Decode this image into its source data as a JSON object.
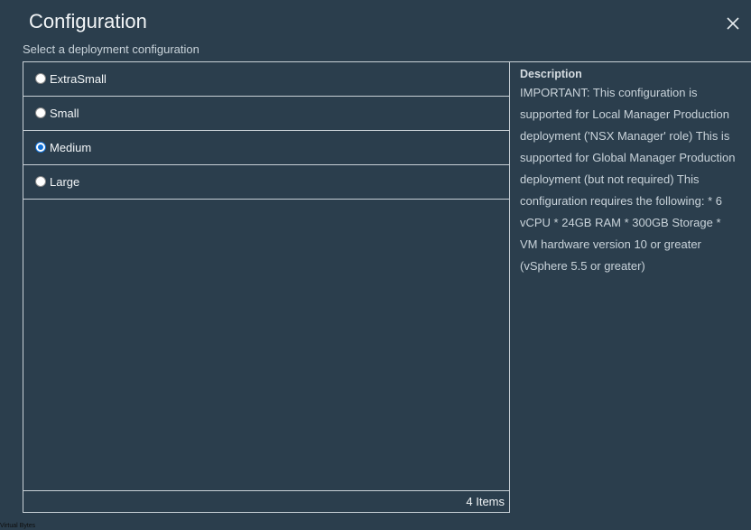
{
  "dialog": {
    "title": "Configuration",
    "subtitle": "Select a deployment configuration"
  },
  "options": [
    {
      "label": "ExtraSmall",
      "selected": false
    },
    {
      "label": "Small",
      "selected": false
    },
    {
      "label": "Medium",
      "selected": true
    },
    {
      "label": "Large",
      "selected": false
    }
  ],
  "list_footer": {
    "count_label": "4 Items"
  },
  "description": {
    "heading": "Description",
    "body": "IMPORTANT: This configuration is supported for Local Manager Production deployment ('NSX Manager' role) This is supported for Global Manager Production deployment (but not required) This configuration requires the following: * 6 vCPU * 24GB RAM * 300GB Storage * VM hardware version 10 or greater (vSphere 5.5 or greater)"
  },
  "watermark": "Virtual Bytes",
  "colors": {
    "background": "#2b3e4d",
    "border": "#c8d0d6",
    "radio_selected": "#0f6fd6"
  },
  "icons": {
    "close": "close-icon"
  }
}
